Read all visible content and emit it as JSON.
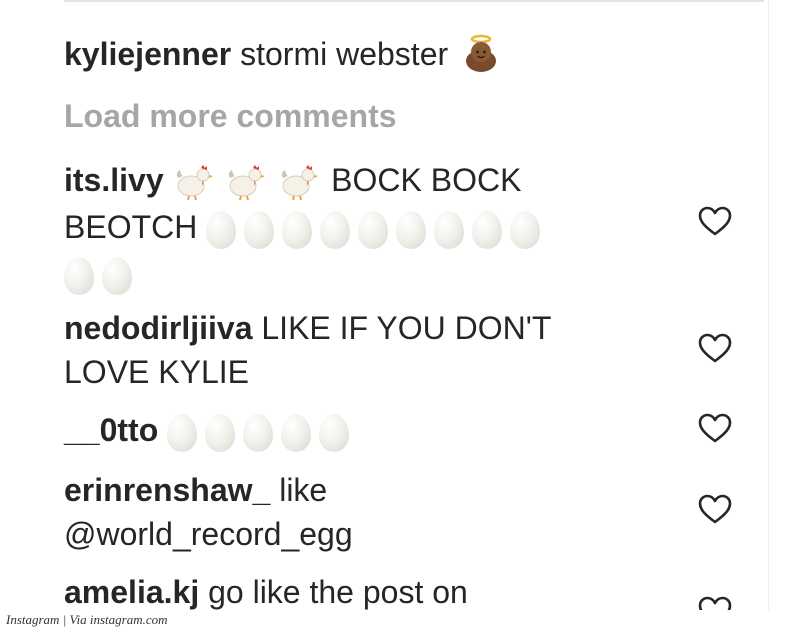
{
  "caption": {
    "username": "kyliejenner",
    "text": "stormi webster",
    "emoji": "baby-angel-icon"
  },
  "load_more": "Load more comments",
  "comments": [
    {
      "username": "its.livy",
      "text_1": "BOCK BOCK",
      "text_2": "BEOTCH",
      "emoji": [
        "chicken x3",
        "egg x11"
      ]
    },
    {
      "username": "nedodirljiiva",
      "text_1": "LIKE IF YOU DON'T",
      "text_2": "LOVE KYLIE"
    },
    {
      "username": "__0tto",
      "emoji": [
        "egg x5"
      ]
    },
    {
      "username": "erinrenshaw_",
      "text_1": "like",
      "text_2": "@world_record_egg"
    },
    {
      "username": "amelia.kj",
      "text_1": "go like the post on"
    }
  ],
  "icons": {
    "like": "heart-outline-icon"
  },
  "credit": "Instagram | Via instagram.com",
  "colors": {
    "text": "#262626",
    "muted": "#a6a6a6",
    "icon": "#262626"
  }
}
